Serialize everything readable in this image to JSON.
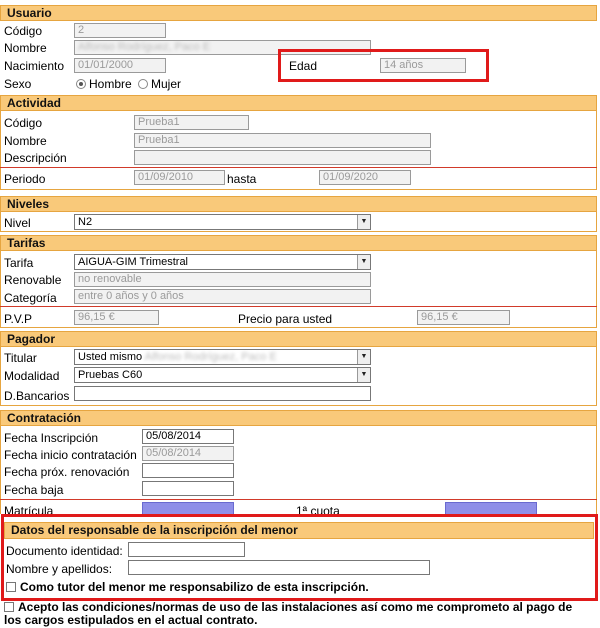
{
  "usuario": {
    "header": "Usuario",
    "codigo_label": "Código",
    "codigo_value": "2",
    "nombre_label": "Nombre",
    "nombre_value": "Alfonso Rodríguez, Paco E",
    "nacimiento_label": "Nacimiento",
    "nacimiento_value": "01/01/2000",
    "edad_label": "Edad",
    "edad_value": "14 años",
    "sexo_label": "Sexo",
    "sexo_options": [
      "Hombre",
      "Mujer"
    ],
    "sexo_selected": "Hombre"
  },
  "actividad": {
    "header": "Actividad",
    "codigo_label": "Código",
    "codigo_value": "Prueba1",
    "nombre_label": "Nombre",
    "nombre_value": "Prueba1",
    "descripcion_label": "Descripción",
    "descripcion_value": "",
    "periodo_label": "Periodo",
    "periodo_from": "01/09/2010",
    "hasta_label": "hasta",
    "periodo_to": "01/09/2020"
  },
  "niveles": {
    "header": "Niveles",
    "nivel_label": "Nivel",
    "nivel_value": "N2"
  },
  "tarifas": {
    "header": "Tarifas",
    "tarifa_label": "Tarifa",
    "tarifa_value": "AIGUA-GIM Trimestral",
    "renovable_label": "Renovable",
    "renovable_value": "no renovable",
    "categoria_label": "Categoría",
    "categoria_value": "entre 0 años y 0 años",
    "pvp_label": "P.V.P",
    "pvp_value": "96,15 €",
    "precio_label": "Precio para usted",
    "precio_value": "96,15 €"
  },
  "pagador": {
    "header": "Pagador",
    "titular_label": "Titular",
    "titular_value": "Usted mismo",
    "titular_name": "Alfonso Rodríguez, Paco E",
    "modalidad_label": "Modalidad",
    "modalidad_value": "Pruebas C60",
    "bancarios_label": "D.Bancarios",
    "bancarios_value": ""
  },
  "contratacion": {
    "header": "Contratación",
    "inscripcion_label": "Fecha Inscripción",
    "inscripcion_value": "05/08/2014",
    "inicio_label": "Fecha inicio contratación",
    "inicio_value": "05/08/2014",
    "renovacion_label": "Fecha próx. renovación",
    "renovacion_value": "",
    "baja_label": "Fecha baja",
    "baja_value": "",
    "matricula_label": "Matrícula",
    "cuota_label": "1ª cuota"
  },
  "responsable": {
    "header": "Datos del responsable de la inscripción del menor",
    "documento_label": "Documento identidad:",
    "documento_value": "",
    "nombre_label": "Nombre y apellidos:",
    "nombre_value": "",
    "tutor_label": "Como tutor del menor me responsabilizo de esta inscripción."
  },
  "acepto": {
    "line1": "Acepto las condiciones/normas de uso de las instalaciones así como me comprometo al pago de",
    "line2": "los cargos estipulados en el actual contrato."
  },
  "colors": {
    "section_header": "#f9c97a",
    "highlight_box": "#e01a1a",
    "separator": "#d13a2a"
  }
}
